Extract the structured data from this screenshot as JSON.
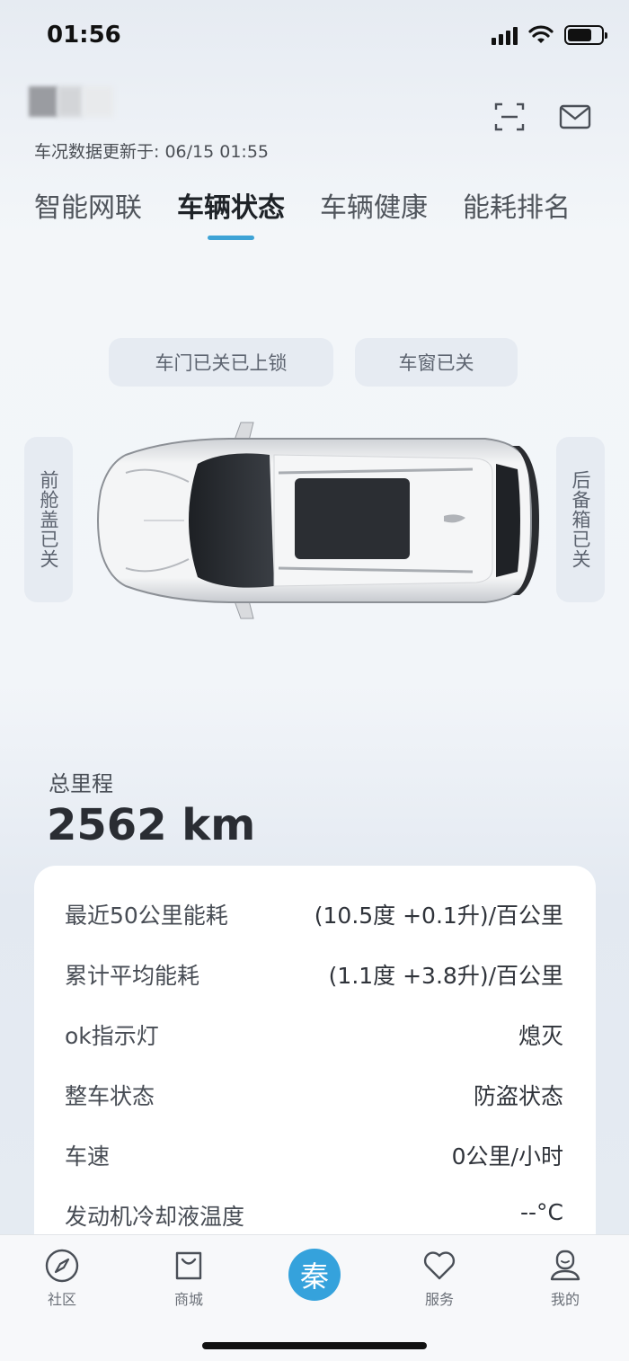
{
  "status_bar": {
    "time": "01:56"
  },
  "header": {
    "update_text": "车况数据更新于: 06/15 01:55"
  },
  "tabs": [
    {
      "label": "智能网联",
      "active": false
    },
    {
      "label": "车辆状态",
      "active": true
    },
    {
      "label": "车辆健康",
      "active": false
    },
    {
      "label": "能耗排名",
      "active": false
    }
  ],
  "vehicle_status": {
    "door": "车门已关已上锁",
    "window": "车窗已关",
    "hood": "前舱盖已关",
    "trunk": "后备箱已关"
  },
  "mileage": {
    "label": "总里程",
    "value": "2562 km"
  },
  "details": [
    {
      "key": "最近50公里能耗",
      "value": "(10.5度 +0.1升)/百公里"
    },
    {
      "key": "累计平均能耗",
      "value": "(1.1度 +3.8升)/百公里"
    },
    {
      "key": "ok指示灯",
      "value": "熄灭"
    },
    {
      "key": "整车状态",
      "value": "防盗状态"
    },
    {
      "key": "车速",
      "value": "0公里/小时"
    },
    {
      "key": "发动机冷却液温度",
      "value": "--°C"
    }
  ],
  "nav": {
    "community": "社区",
    "mall": "商城",
    "center": "秦",
    "service": "服务",
    "mine": "我的"
  },
  "colors": {
    "accent": "#3ea3d6",
    "chip_bg": "#e6ebf2"
  }
}
